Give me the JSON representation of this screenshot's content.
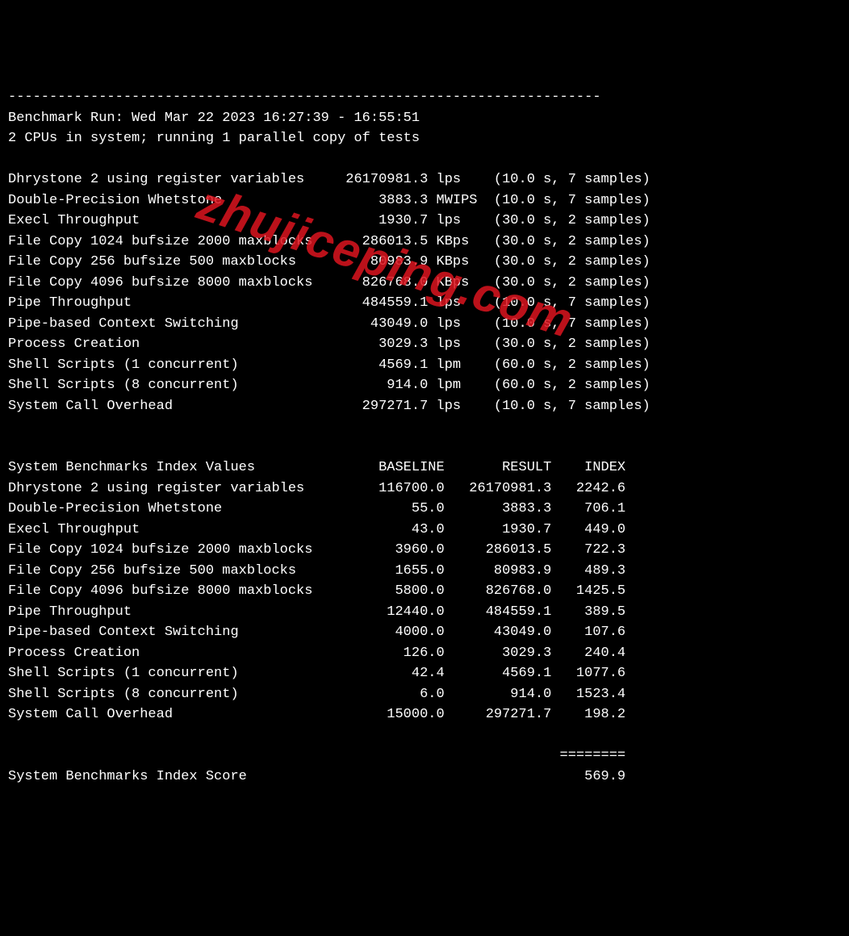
{
  "separator": "------------------------------------------------------------------------",
  "header": {
    "run_line": "Benchmark Run: Wed Mar 22 2023 16:27:39 - 16:55:51",
    "cpu_line": "2 CPUs in system; running 1 parallel copy of tests"
  },
  "tests": [
    {
      "name": "Dhrystone 2 using register variables",
      "value": "26170981.3",
      "unit": "lps",
      "timing": "(10.0 s, 7 samples)"
    },
    {
      "name": "Double-Precision Whetstone",
      "value": "3883.3",
      "unit": "MWIPS",
      "timing": "(10.0 s, 7 samples)"
    },
    {
      "name": "Execl Throughput",
      "value": "1930.7",
      "unit": "lps",
      "timing": "(30.0 s, 2 samples)"
    },
    {
      "name": "File Copy 1024 bufsize 2000 maxblocks",
      "value": "286013.5",
      "unit": "KBps",
      "timing": "(30.0 s, 2 samples)"
    },
    {
      "name": "File Copy 256 bufsize 500 maxblocks",
      "value": "80983.9",
      "unit": "KBps",
      "timing": "(30.0 s, 2 samples)"
    },
    {
      "name": "File Copy 4096 bufsize 8000 maxblocks",
      "value": "826768.0",
      "unit": "KBps",
      "timing": "(30.0 s, 2 samples)"
    },
    {
      "name": "Pipe Throughput",
      "value": "484559.1",
      "unit": "lps",
      "timing": "(10.0 s, 7 samples)"
    },
    {
      "name": "Pipe-based Context Switching",
      "value": "43049.0",
      "unit": "lps",
      "timing": "(10.0 s, 7 samples)"
    },
    {
      "name": "Process Creation",
      "value": "3029.3",
      "unit": "lps",
      "timing": "(30.0 s, 2 samples)"
    },
    {
      "name": "Shell Scripts (1 concurrent)",
      "value": "4569.1",
      "unit": "lpm",
      "timing": "(60.0 s, 2 samples)"
    },
    {
      "name": "Shell Scripts (8 concurrent)",
      "value": "914.0",
      "unit": "lpm",
      "timing": "(60.0 s, 2 samples)"
    },
    {
      "name": "System Call Overhead",
      "value": "297271.7",
      "unit": "lps",
      "timing": "(10.0 s, 7 samples)"
    }
  ],
  "index_header": {
    "title": "System Benchmarks Index Values",
    "col_baseline": "BASELINE",
    "col_result": "RESULT",
    "col_index": "INDEX"
  },
  "index_rows": [
    {
      "name": "Dhrystone 2 using register variables",
      "baseline": "116700.0",
      "result": "26170981.3",
      "index": "2242.6"
    },
    {
      "name": "Double-Precision Whetstone",
      "baseline": "55.0",
      "result": "3883.3",
      "index": "706.1"
    },
    {
      "name": "Execl Throughput",
      "baseline": "43.0",
      "result": "1930.7",
      "index": "449.0"
    },
    {
      "name": "File Copy 1024 bufsize 2000 maxblocks",
      "baseline": "3960.0",
      "result": "286013.5",
      "index": "722.3"
    },
    {
      "name": "File Copy 256 bufsize 500 maxblocks",
      "baseline": "1655.0",
      "result": "80983.9",
      "index": "489.3"
    },
    {
      "name": "File Copy 4096 bufsize 8000 maxblocks",
      "baseline": "5800.0",
      "result": "826768.0",
      "index": "1425.5"
    },
    {
      "name": "Pipe Throughput",
      "baseline": "12440.0",
      "result": "484559.1",
      "index": "389.5"
    },
    {
      "name": "Pipe-based Context Switching",
      "baseline": "4000.0",
      "result": "43049.0",
      "index": "107.6"
    },
    {
      "name": "Process Creation",
      "baseline": "126.0",
      "result": "3029.3",
      "index": "240.4"
    },
    {
      "name": "Shell Scripts (1 concurrent)",
      "baseline": "42.4",
      "result": "4569.1",
      "index": "1077.6"
    },
    {
      "name": "Shell Scripts (8 concurrent)",
      "baseline": "6.0",
      "result": "914.0",
      "index": "1523.4"
    },
    {
      "name": "System Call Overhead",
      "baseline": "15000.0",
      "result": "297271.7",
      "index": "198.2"
    }
  ],
  "score_rule": "                                                                   ========",
  "score": {
    "label": "System Benchmarks Index Score",
    "value": "569.9"
  },
  "watermark": "zhujiceping.com"
}
